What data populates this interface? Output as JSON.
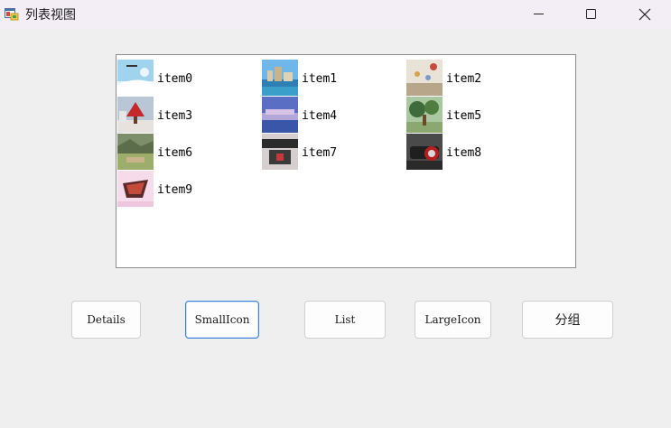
{
  "window": {
    "title": "列表视图",
    "app_icon": "winforms-app-icon",
    "controls": [
      "minimize-icon",
      "maximize-icon",
      "close-icon"
    ]
  },
  "listview": {
    "view_mode": "SmallIcon",
    "items": [
      {
        "label": "item0",
        "icon": "photo-sky-thumbnail"
      },
      {
        "label": "item1",
        "icon": "photo-city-thumbnail"
      },
      {
        "label": "item2",
        "icon": "photo-balloons-thumbnail"
      },
      {
        "label": "item3",
        "icon": "photo-tree-thumbnail"
      },
      {
        "label": "item4",
        "icon": "photo-waterfront-thumbnail"
      },
      {
        "label": "item5",
        "icon": "photo-garden-thumbnail"
      },
      {
        "label": "item6",
        "icon": "photo-valley-thumbnail"
      },
      {
        "label": "item7",
        "icon": "photo-car-interior-thumbnail"
      },
      {
        "label": "item8",
        "icon": "photo-car-thumbnail"
      },
      {
        "label": "item9",
        "icon": "photo-food-thumbnail"
      }
    ]
  },
  "buttons": {
    "details": "Details",
    "small_icon": "SmallIcon",
    "list": "List",
    "large_icon": "LargeIcon",
    "group": "分组"
  },
  "colors": {
    "titlebar": "#f3eef6",
    "window_bg": "#efefef",
    "focus_border": "#3d84d8"
  }
}
